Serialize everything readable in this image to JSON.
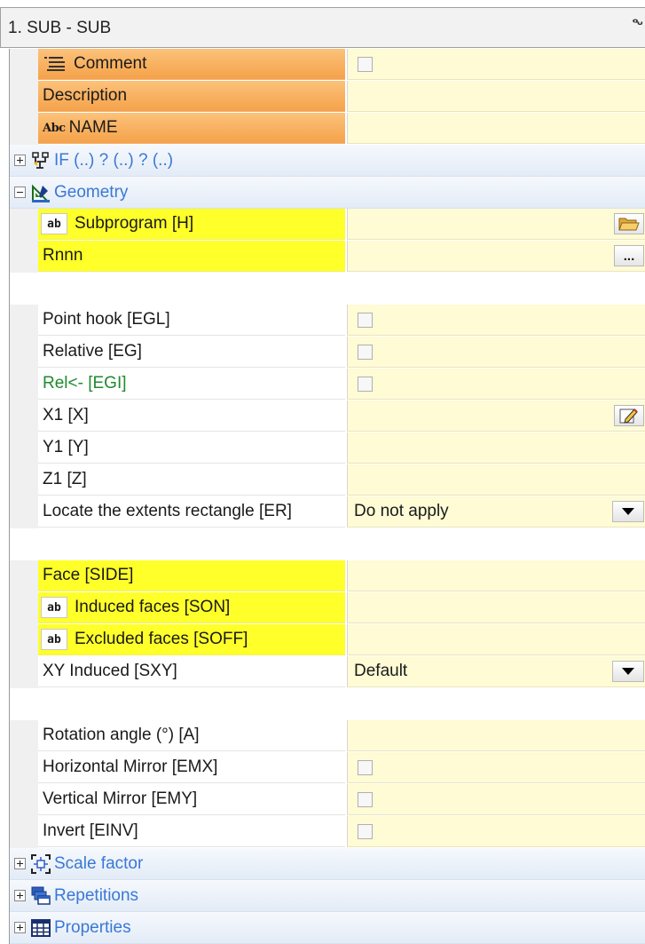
{
  "panel": {
    "title": "1. SUB - SUB",
    "pin": "ᖕ"
  },
  "rows": {
    "comment": {
      "label": "Comment",
      "checked": false
    },
    "description": {
      "label": "Description",
      "value": ""
    },
    "name": {
      "icon_text": "Abc",
      "label": "NAME",
      "value": ""
    },
    "if_group": {
      "label": "IF (..) ? (..) ? (..)",
      "expanded": false
    },
    "geometry_group": {
      "label": "Geometry",
      "expanded": true
    },
    "subprogram": {
      "icon_text": "ab",
      "label": "Subprogram [H]",
      "value": ""
    },
    "rnnn": {
      "label": "Rnnn",
      "value": "",
      "button": "..."
    },
    "point_hook": {
      "label": "Point hook [EGL]",
      "checked": false
    },
    "relative": {
      "label": "Relative [EG]",
      "checked": false
    },
    "rel_inv": {
      "label": "Rel<- [EGI]",
      "checked": false
    },
    "x1": {
      "label": "X1 [X]",
      "value": ""
    },
    "y1": {
      "label": "Y1 [Y]",
      "value": ""
    },
    "z1": {
      "label": "Z1 [Z]",
      "value": ""
    },
    "extents": {
      "label": "Locate the extents rectangle [ER]",
      "value": "Do not apply"
    },
    "face": {
      "label": "Face [SIDE]",
      "value": ""
    },
    "induced_faces": {
      "icon_text": "ab",
      "label": "Induced faces [SON]",
      "value": ""
    },
    "excluded_faces": {
      "icon_text": "ab",
      "label": "Excluded faces [SOFF]",
      "value": ""
    },
    "xy_induced": {
      "label": "XY Induced [SXY]",
      "value": "Default"
    },
    "rotation": {
      "label": "Rotation angle (°) [A]",
      "value": ""
    },
    "hmirror": {
      "label": "Horizontal Mirror [EMX]",
      "checked": false
    },
    "vmirror": {
      "label": "Vertical Mirror [EMY]",
      "checked": false
    },
    "invert": {
      "label": "Invert [EINV]",
      "checked": false
    },
    "scale_group": {
      "label": "Scale factor",
      "expanded": false
    },
    "repetitions_group": {
      "label": "Repetitions",
      "expanded": false
    },
    "properties_group": {
      "label": "Properties",
      "expanded": false
    }
  },
  "colors": {
    "value_bg": "#fefbd5",
    "orange": "#f5a24a",
    "yellow": "#ffff2a",
    "group_text": "#3a78d6",
    "green_text": "#1f8a2e"
  },
  "icons": {
    "comment": "comment-lines-icon",
    "if": "tree-branch-icon",
    "geometry": "ruler-triangle-icon",
    "folder": "folder-open-icon",
    "edit": "edit-pencil-icon",
    "dropdown": "triangle-down-icon",
    "scale": "scale-frame-icon",
    "repetitions": "stacked-windows-icon",
    "properties": "grid-table-icon"
  }
}
